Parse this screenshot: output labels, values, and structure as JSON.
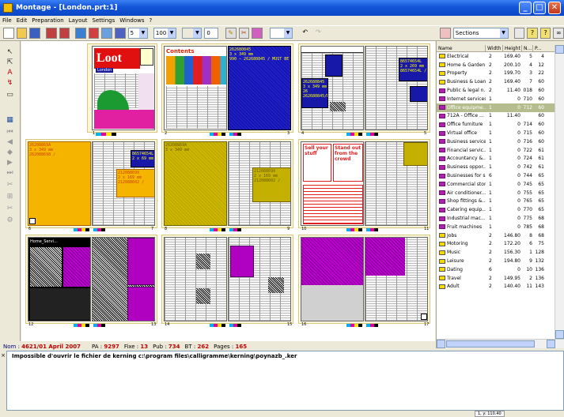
{
  "window": {
    "title": "Montage - [London.prt:1]",
    "min": "_",
    "max": "□",
    "close": "✕"
  },
  "menu": [
    "File",
    "Edit",
    "Preparation",
    "Layout",
    "Settings",
    "Windows",
    "?"
  ],
  "toolbar": {
    "page_count": "5",
    "zoom": "100",
    "empty_field": "",
    "offset": "0",
    "sections_label": "Sections",
    "undo": "↶",
    "redo": "↷"
  },
  "pages": {
    "loot_title": "Loot",
    "loot_sub": "London",
    "contents_title": "Contents",
    "blue1": "262680845\n3 x 349 mm\n990 – 262680845 / MUST BE P2",
    "blue2": "86574654L\n2 x 269 mm\n86574654L / MUST BE",
    "blue3": "262680845\n3 x 349 mm\n26\n262680845/MU",
    "orange1": "26208869A\n3 x 349 mm\n262088698 /",
    "orange2": "86574654L\n2 x 69 mm",
    "orange3": "21208869X\n2 x 169 mm\n212088602 /",
    "olive1": "26208869A\n3 x 349 mm",
    "olive2": "21208869X\n2 x 169 mm\n212088602 /",
    "ad1": "Sell your stuff",
    "ad2": "Stand out from the crowd",
    "fruit_title": "Home_Servi…",
    "numbers": [
      "1",
      "2",
      "3",
      "4",
      "5",
      "6",
      "7",
      "8",
      "9",
      "10",
      "11",
      "12",
      "13",
      "14",
      "15",
      "16",
      "17",
      "18",
      "19"
    ]
  },
  "sections": {
    "headers": {
      "name": "Name",
      "width": "Width",
      "height": "Height",
      "n": "N...",
      "p": "P..."
    },
    "rows": [
      {
        "name": "Electrical",
        "width": "2",
        "height": "169.40",
        "n": "5",
        "p": "4",
        "color": "yellow"
      },
      {
        "name": "Home & Garden",
        "width": "2",
        "height": "200.10",
        "n": "4",
        "p": "12",
        "color": "yellow"
      },
      {
        "name": "Property",
        "width": "2",
        "height": "199.70",
        "n": "3",
        "p": "22",
        "color": "yellow"
      },
      {
        "name": "Business & Loans",
        "width": "2",
        "height": "169.40",
        "n": "7",
        "p": "60",
        "color": "yellow"
      },
      {
        "name": "Public & legal n...",
        "width": "2",
        "height": "11.40",
        "n": "018",
        "p": "60",
        "color": "magenta"
      },
      {
        "name": "Internet services",
        "width": "1",
        "height": "0",
        "n": "710",
        "p": "60",
        "color": "magenta"
      },
      {
        "name": "Office equipme...",
        "width": "1",
        "height": "0",
        "n": "712",
        "p": "60",
        "color": "magenta",
        "selected": true
      },
      {
        "name": "712A - Office ...",
        "width": "1",
        "height": "11.40",
        "n": "",
        "p": "60",
        "color": "magenta"
      },
      {
        "name": "Office furniture",
        "width": "1",
        "height": "0",
        "n": "714",
        "p": "60",
        "color": "magenta"
      },
      {
        "name": "Virtual office",
        "width": "1",
        "height": "0",
        "n": "715",
        "p": "60",
        "color": "magenta"
      },
      {
        "name": "Business services",
        "width": "1",
        "height": "0",
        "n": "716",
        "p": "60",
        "color": "magenta"
      },
      {
        "name": "Financial servic...",
        "width": "1",
        "height": "0",
        "n": "722",
        "p": "61",
        "color": "magenta"
      },
      {
        "name": "Accountancy &...",
        "width": "1",
        "height": "0",
        "n": "724",
        "p": "61",
        "color": "magenta"
      },
      {
        "name": "Business oppor...",
        "width": "1",
        "height": "0",
        "n": "742",
        "p": "61",
        "color": "magenta"
      },
      {
        "name": "Businesses for sale",
        "width": "6",
        "height": "0",
        "n": "744",
        "p": "65",
        "color": "magenta"
      },
      {
        "name": "Commercial storage",
        "width": "1",
        "height": "0",
        "n": "745",
        "p": "65",
        "color": "magenta"
      },
      {
        "name": "Air conditioner...",
        "width": "1",
        "height": "0",
        "n": "755",
        "p": "65",
        "color": "magenta"
      },
      {
        "name": "Shop fittings &...",
        "width": "1",
        "height": "0",
        "n": "765",
        "p": "65",
        "color": "magenta"
      },
      {
        "name": "Catering equip...",
        "width": "1",
        "height": "0",
        "n": "770",
        "p": "65",
        "color": "magenta"
      },
      {
        "name": "Industrial mac...",
        "width": "1",
        "height": "0",
        "n": "775",
        "p": "68",
        "color": "magenta"
      },
      {
        "name": "Fruit machines",
        "width": "1",
        "height": "0",
        "n": "785",
        "p": "68",
        "color": "magenta"
      },
      {
        "name": "Jobs",
        "width": "2",
        "height": "146.80",
        "n": "8",
        "p": "68",
        "color": "yellow"
      },
      {
        "name": "Motoring",
        "width": "2",
        "height": "172.20",
        "n": "6",
        "p": "75",
        "color": "yellow"
      },
      {
        "name": "Music",
        "width": "2",
        "height": "156.30",
        "n": "1",
        "p": "128",
        "color": "yellow"
      },
      {
        "name": "Leisure",
        "width": "2",
        "height": "194.80",
        "n": "9",
        "p": "132",
        "color": "yellow"
      },
      {
        "name": "Dating",
        "width": "6",
        "height": "0",
        "n": "10",
        "p": "136",
        "color": "yellow"
      },
      {
        "name": "Travel",
        "width": "2",
        "height": "149.95",
        "n": "2",
        "p": "136",
        "color": "yellow"
      },
      {
        "name": "Adult",
        "width": "2",
        "height": "140.40",
        "n": "11",
        "p": "143",
        "color": "yellow"
      }
    ]
  },
  "status": {
    "nom_label": "Nom :",
    "nom_value": "4621/01 April 2007",
    "pa_label": "PA :",
    "pa_value": "9297",
    "fixe_label": "Fixe :",
    "fixe_value": "13",
    "pub_label": "Pub :",
    "pub_value": "734",
    "bt_label": "BT :",
    "bt_value": "262",
    "pages_label": "Pages :",
    "pages_value": "165"
  },
  "message": "Impossible d'ouvrir le fichier de kerning c:\\program files\\calligramme\\kerning\\poynazb_.ker",
  "message_close": "×",
  "zoom_readout": "1, y: 110.40",
  "colors": {
    "title": "#0a46c8",
    "selection": "#b5bc8e",
    "section_yellow": "#f8d800",
    "section_magenta": "#b020b0"
  }
}
